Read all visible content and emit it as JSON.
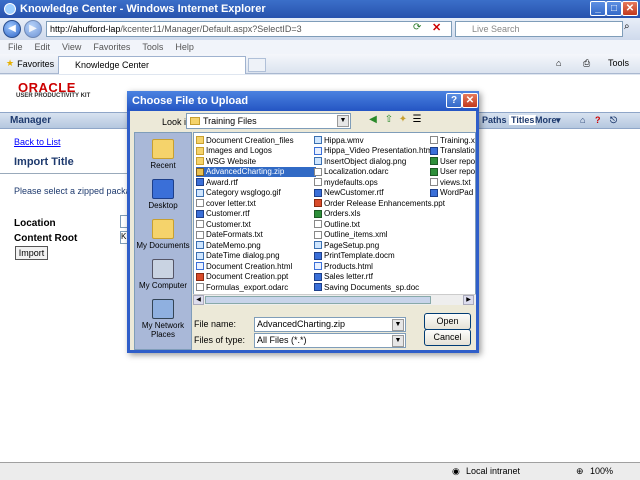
{
  "ie": {
    "title": "Knowledge Center - Windows Internet Explorer",
    "address_host": "http://ahufford-lap",
    "address_path": "/kcenter11/Manager/Default.aspx?SelectID=3",
    "search_placeholder": "Live Search",
    "menu": [
      "File",
      "Edit",
      "View",
      "Favorites",
      "Tools",
      "Help"
    ],
    "favorites_label": "Favorites",
    "tab_label": "Knowledge Center",
    "tools_label": "Tools"
  },
  "page": {
    "logo": "ORACLE",
    "logo_sub": "USER PRODUCTIVITY KIT",
    "bar_title": "Manager",
    "nav_paths": "Paths",
    "nav_titles": "Titles",
    "nav_more": "More",
    "back_link": "Back to List",
    "heading": "Import Title",
    "instruction": "Please select a zipped package t",
    "location_label": "Location",
    "content_root_label": "Content Root",
    "content_root_value": "K",
    "import_button": "Import"
  },
  "dialog": {
    "title": "Choose File to Upload",
    "look_in_label": "Look in:",
    "look_in_value": "Training Files",
    "places": [
      "Recent",
      "Desktop",
      "My Documents",
      "My Computer",
      "My Network Places"
    ],
    "columns": [
      [
        {
          "name": "Document Creation_files",
          "type": "fold"
        },
        {
          "name": "Images and Logos",
          "type": "fold"
        },
        {
          "name": "WSG Website",
          "type": "fold"
        },
        {
          "name": "AdvancedCharting.zip",
          "type": "zip",
          "selected": true
        },
        {
          "name": "Award.rtf",
          "type": "doc"
        },
        {
          "name": "Category wsglogo.gif",
          "type": "img"
        },
        {
          "name": "cover letter.txt",
          "type": "txt"
        },
        {
          "name": "Customer.rtf",
          "type": "doc"
        },
        {
          "name": "Customer.txt",
          "type": "txt"
        },
        {
          "name": "DateFormats.txt",
          "type": "txt"
        },
        {
          "name": "DateMemo.png",
          "type": "img"
        },
        {
          "name": "DateTime dialog.png",
          "type": "img"
        },
        {
          "name": "Document Creation.html",
          "type": "html"
        },
        {
          "name": "Document Creation.ppt",
          "type": "ppt"
        },
        {
          "name": "Formulas_export.odarc",
          "type": "txt"
        }
      ],
      [
        {
          "name": "Hippa.wmv",
          "type": "img"
        },
        {
          "name": "Hippa_Video Presentation.html",
          "type": "html"
        },
        {
          "name": "InsertObject dialog.png",
          "type": "img"
        },
        {
          "name": "Localization.odarc",
          "type": "txt"
        },
        {
          "name": "mydefaults.ops",
          "type": "txt"
        },
        {
          "name": "NewCustomer.rtf",
          "type": "doc"
        },
        {
          "name": "Order Release Enhancements.ppt",
          "type": "ppt"
        },
        {
          "name": "Orders.xls",
          "type": "xls"
        },
        {
          "name": "Outline.txt",
          "type": "txt"
        },
        {
          "name": "Outline_items.xml",
          "type": "txt"
        },
        {
          "name": "PageSetup.png",
          "type": "img"
        },
        {
          "name": "PrintTemplate.docm",
          "type": "doc"
        },
        {
          "name": "Products.html",
          "type": "html"
        },
        {
          "name": "Sales letter.rtf",
          "type": "doc"
        },
        {
          "name": "Saving Documents_sp.doc",
          "type": "doc"
        }
      ],
      [
        {
          "name": "Training.x",
          "type": "txt"
        },
        {
          "name": "Translation",
          "type": "doc"
        },
        {
          "name": "User repo",
          "type": "xls"
        },
        {
          "name": "User repo",
          "type": "xls"
        },
        {
          "name": "views.txt",
          "type": "txt"
        },
        {
          "name": "WordPad",
          "type": "doc"
        }
      ]
    ],
    "file_name_label": "File name:",
    "file_name_value": "AdvancedCharting.zip",
    "file_type_label": "Files of type:",
    "file_type_value": "All Files (*.*)",
    "open_button": "Open",
    "cancel_button": "Cancel"
  },
  "status": {
    "zone": "Local intranet",
    "zoom": "100%"
  }
}
